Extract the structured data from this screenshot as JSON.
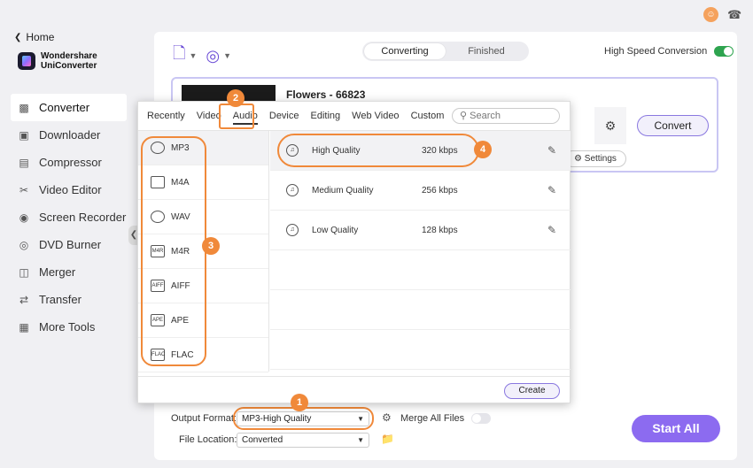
{
  "sidebar": {
    "home_label": "Home",
    "brand_line1": "Wondershare",
    "brand_line2": "UniConverter",
    "items": [
      {
        "label": "Converter",
        "icon": "converter-icon"
      },
      {
        "label": "Downloader",
        "icon": "download-icon"
      },
      {
        "label": "Compressor",
        "icon": "compress-icon"
      },
      {
        "label": "Video Editor",
        "icon": "scissors-icon"
      },
      {
        "label": "Screen Recorder",
        "icon": "record-icon"
      },
      {
        "label": "DVD Burner",
        "icon": "disc-icon"
      },
      {
        "label": "Merger",
        "icon": "merge-icon"
      },
      {
        "label": "Transfer",
        "icon": "transfer-icon"
      },
      {
        "label": "More Tools",
        "icon": "grid-icon"
      }
    ],
    "active": "Converter"
  },
  "header": {
    "tabs": [
      {
        "label": "Converting"
      },
      {
        "label": "Finished"
      }
    ],
    "active_tab": "Converting",
    "high_speed_label": "High Speed Conversion",
    "high_speed_on": true
  },
  "file": {
    "title": "Flowers - 66823",
    "convert_label": "Convert",
    "settings_label": "Settings"
  },
  "popup": {
    "tabs": [
      "Recently",
      "Video",
      "Audio",
      "Device",
      "Editing",
      "Web Video",
      "Custom"
    ],
    "active_tab": "Audio",
    "search_placeholder": "Search",
    "formats": [
      {
        "label": "MP3",
        "icon_text": ""
      },
      {
        "label": "M4A",
        "icon_text": ""
      },
      {
        "label": "WAV",
        "icon_text": ""
      },
      {
        "label": "M4R",
        "icon_text": "M4R"
      },
      {
        "label": "AIFF",
        "icon_text": "AIFF"
      },
      {
        "label": "APE",
        "icon_text": "APE"
      },
      {
        "label": "FLAC",
        "icon_text": "FLAC"
      }
    ],
    "qualities": [
      {
        "name": "High Quality",
        "rate": "320 kbps"
      },
      {
        "name": "Medium Quality",
        "rate": "256 kbps"
      },
      {
        "name": "Low Quality",
        "rate": "128 kbps"
      }
    ],
    "create_label": "Create"
  },
  "bottom": {
    "output_format_label": "Output Format:",
    "output_format_value": "MP3-High Quality",
    "merge_label": "Merge All Files",
    "file_location_label": "File Location:",
    "file_location_value": "Converted",
    "start_all_label": "Start All"
  },
  "badges": [
    "1",
    "2",
    "3",
    "4"
  ],
  "colors": {
    "accent": "#8c6bf0",
    "callout": "#f0893a",
    "toggle_on": "#2ea44f"
  }
}
